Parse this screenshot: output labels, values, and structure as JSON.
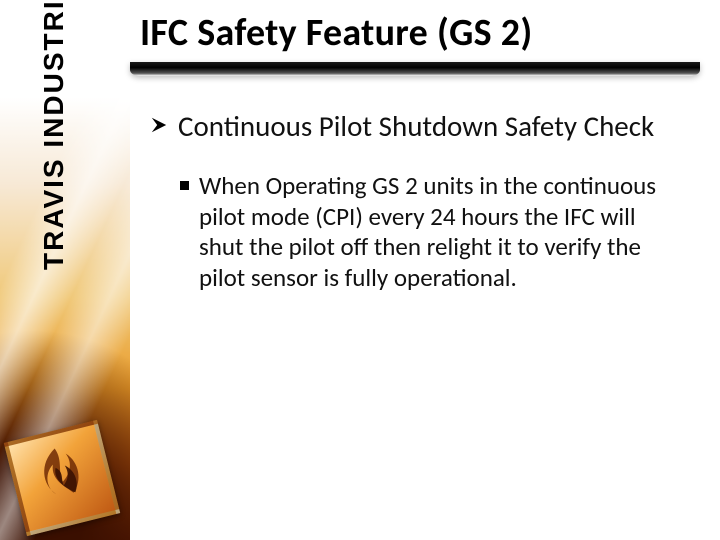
{
  "brand": "TRAVIS INDUSTRIES",
  "title": "IFC Safety Feature (GS 2)",
  "bullets": {
    "main": "Continuous Pilot Shutdown Safety Check",
    "sub": "When Operating GS 2 units in the continuous pilot mode (CPI) every 24 hours the IFC will shut the pilot off then relight it to verify the pilot sensor is fully operational."
  }
}
